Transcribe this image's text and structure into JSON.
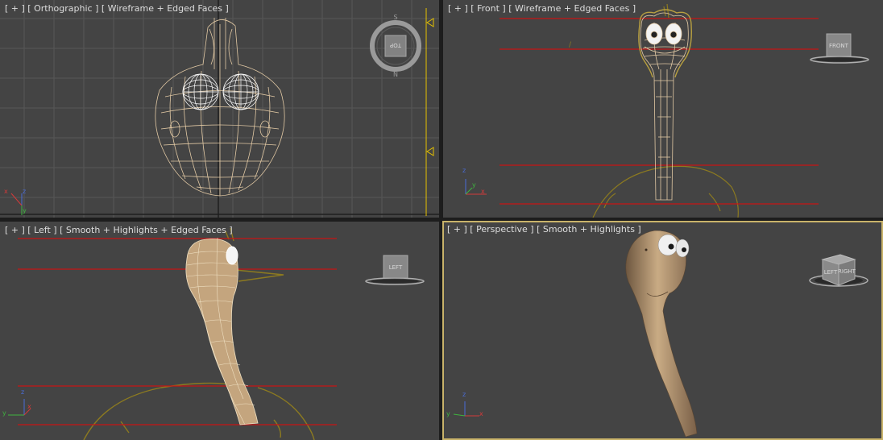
{
  "viewports": {
    "top_left": {
      "menu": "[ + ]",
      "view": "[ Orthographic ]",
      "shading": "[ Wireframe + Edged Faces ]",
      "viewcube": "TOP"
    },
    "top_right": {
      "menu": "[ + ]",
      "view": "[ Front ]",
      "shading": "[ Wireframe + Edged Faces ]",
      "viewcube": "FRONT"
    },
    "bottom_left": {
      "menu": "[ + ]",
      "view": "[ Left ]",
      "shading": "[ Smooth + Highlights + Edged Faces ]",
      "viewcube": "LEFT"
    },
    "bottom_right": {
      "menu": "[ + ]",
      "view": "[ Perspective ]",
      "shading": "[ Smooth + Highlights ]",
      "viewcube_left": "LEFT",
      "viewcube_right": "RIGHT"
    }
  },
  "axes": {
    "x": "x",
    "y": "y",
    "z": "z"
  },
  "colors": {
    "viewport_bg": "#444444",
    "grid": "#575757",
    "wire": "#e2c9a4",
    "skin": "#b89a74",
    "guide_line": "#c81414",
    "sketch": "#8c7a20",
    "active_border": "#c9b36a",
    "axis_x": "#d43a3a",
    "axis_y": "#3fb33f",
    "axis_z": "#4a6cd6"
  }
}
